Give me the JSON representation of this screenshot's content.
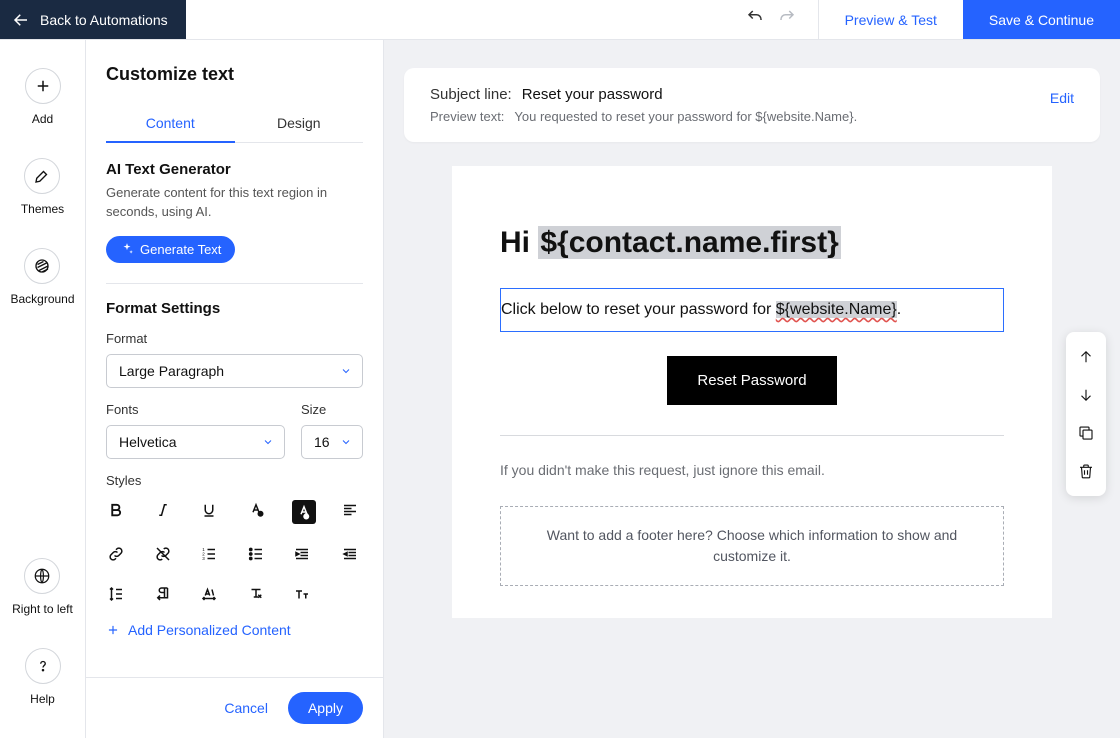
{
  "topbar": {
    "back": "Back to Automations",
    "preview": "Preview & Test",
    "save": "Save & Continue"
  },
  "rail": {
    "add": "Add",
    "themes": "Themes",
    "background": "Background",
    "rtl": "Right to left",
    "help": "Help"
  },
  "panel": {
    "title": "Customize text",
    "tabs": {
      "content": "Content",
      "design": "Design"
    },
    "ai": {
      "heading": "AI Text Generator",
      "desc": "Generate content for this text region in seconds, using AI.",
      "button": "Generate Text"
    },
    "format": {
      "heading": "Format Settings",
      "format_label": "Format",
      "format_value": "Large Paragraph",
      "fonts_label": "Fonts",
      "fonts_value": "Helvetica",
      "size_label": "Size",
      "size_value": "16",
      "styles_label": "Styles"
    },
    "add_personalized": "Add Personalized Content",
    "cancel": "Cancel",
    "apply": "Apply"
  },
  "subject": {
    "subject_label": "Subject line:",
    "subject_value": "Reset your password",
    "preview_label": "Preview text:",
    "preview_value": "You requested to reset your password for ${website.Name}.",
    "edit": "Edit"
  },
  "email": {
    "greeting_prefix": "Hi ",
    "greeting_var": "${contact.name.first}",
    "body_prefix": "Click below to reset your password for ",
    "body_var": "${website.Name}",
    "body_suffix": ".",
    "button": "Reset Password",
    "ignore": "If you didn't make this request, just ignore this email.",
    "footer_placeholder": "Want to add a footer here? Choose which information to show and customize it."
  }
}
